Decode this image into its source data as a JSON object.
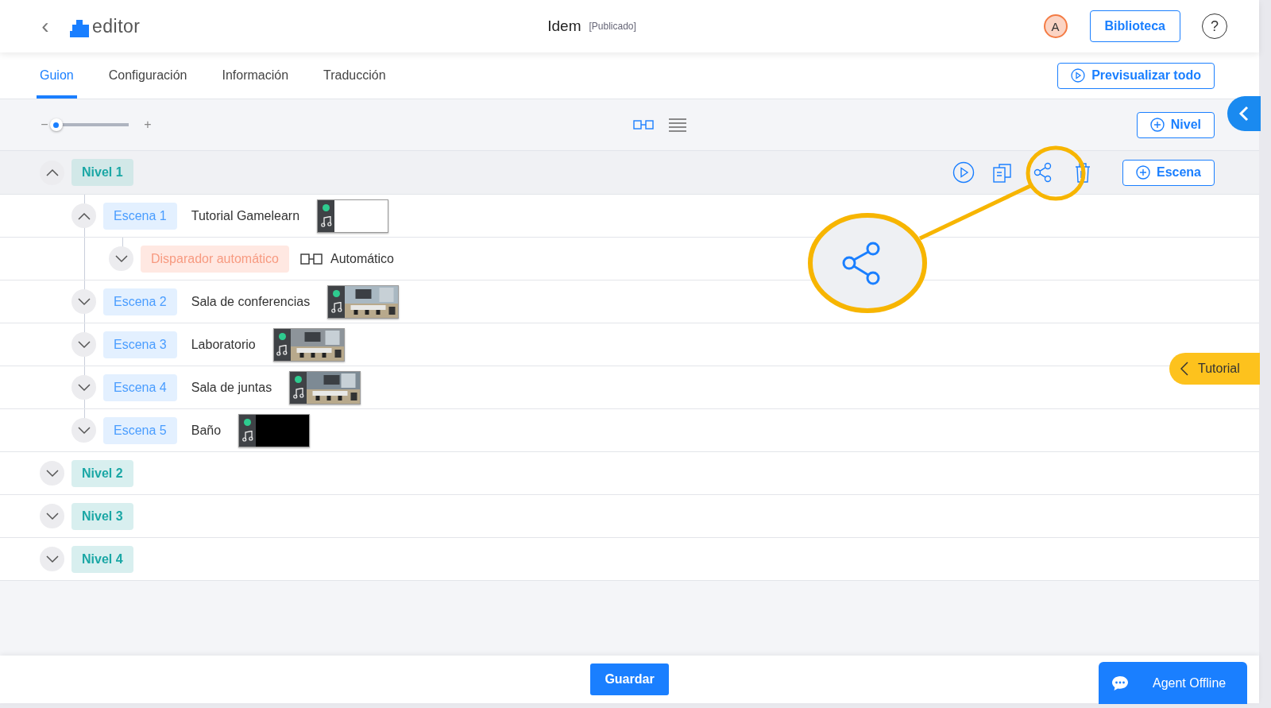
{
  "header": {
    "back": "‹",
    "logo": "editor",
    "title": "Idem",
    "status": "[Publicado]",
    "avatar": "A",
    "library_button": "Biblioteca",
    "help": "?"
  },
  "tabs": [
    {
      "label": "Guion",
      "selected": true
    },
    {
      "label": "Configuración",
      "selected": false
    },
    {
      "label": "Información",
      "selected": false
    },
    {
      "label": "Traducción",
      "selected": false
    }
  ],
  "preview_button": "Previsualizar todo",
  "toolbar": {
    "zoom_minus": "−",
    "zoom_plus": "+",
    "zoom": {
      "level": 0.05
    },
    "add_level_button": "Nivel"
  },
  "levels": [
    {
      "label": "Nivel 1",
      "expanded": true,
      "add_scene_button": "Escena",
      "scenes": [
        {
          "label": "Escena 1",
          "title": "Tutorial Gamelearn",
          "expanded": true,
          "thumbnail": {
            "kind": "blank"
          },
          "triggers": [
            {
              "label": "Disparador automático",
              "expanded": false,
              "type": "Automático"
            }
          ]
        },
        {
          "label": "Escena 2",
          "title": "Sala de conferencias",
          "expanded": false
        },
        {
          "label": "Escena 3",
          "title": "Laboratorio",
          "expanded": false
        },
        {
          "label": "Escena 4",
          "title": "Sala de juntas",
          "expanded": false
        },
        {
          "label": "Escena 5",
          "title": "Baño",
          "expanded": false,
          "thumbnail": {
            "kind": "black"
          }
        }
      ]
    },
    {
      "label": "Nivel 2",
      "expanded": false
    },
    {
      "label": "Nivel 3",
      "expanded": false
    },
    {
      "label": "Nivel 4",
      "expanded": false
    }
  ],
  "tutorial_tab": "Tutorial",
  "save_button": "Guardar",
  "chat_button": "Agent Offline"
}
